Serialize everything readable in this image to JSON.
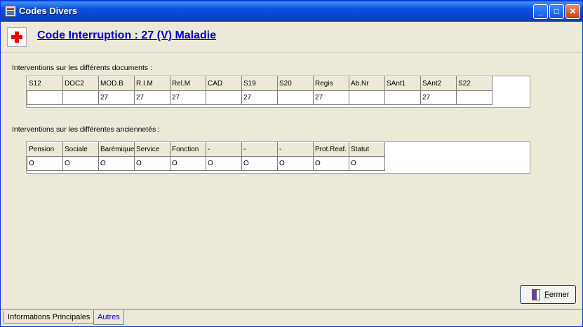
{
  "window": {
    "title": "Codes Divers"
  },
  "header": {
    "title": "Code Interruption : 27 (V) Maladie"
  },
  "documents": {
    "label": "Interventions sur les différents documents :",
    "columns": [
      "S12",
      "DOC2",
      "MOD.B",
      "R.I.M",
      "Rel.M",
      "CAD",
      "S19",
      "S20",
      "Regis",
      "Ab.Nr",
      "SAnt1",
      "SAnt2",
      "S22"
    ],
    "values": [
      "",
      "",
      "27",
      "27",
      "27",
      "",
      "27",
      "",
      "27",
      "",
      "",
      "27",
      ""
    ]
  },
  "anciennetes": {
    "label": "Interventions sur les différentes anciennetés :",
    "columns": [
      "Pension",
      "Sociale",
      "Barémique",
      "Service",
      "Fonction",
      "-",
      "-",
      "-",
      "Prot.Reaf.",
      "Statut"
    ],
    "values": [
      "O",
      "O",
      "O",
      "O",
      "O",
      "O",
      "O",
      "O",
      "O",
      "O"
    ]
  },
  "buttons": {
    "fermer_accel": "F",
    "fermer_rest": "ermer"
  },
  "tabs": [
    "Informations Principales",
    "Autres"
  ],
  "colors": {
    "titlebar": "#0a4ed8",
    "heading": "#0000cc",
    "cross": "#e00000",
    "background": "#ece9d8"
  }
}
